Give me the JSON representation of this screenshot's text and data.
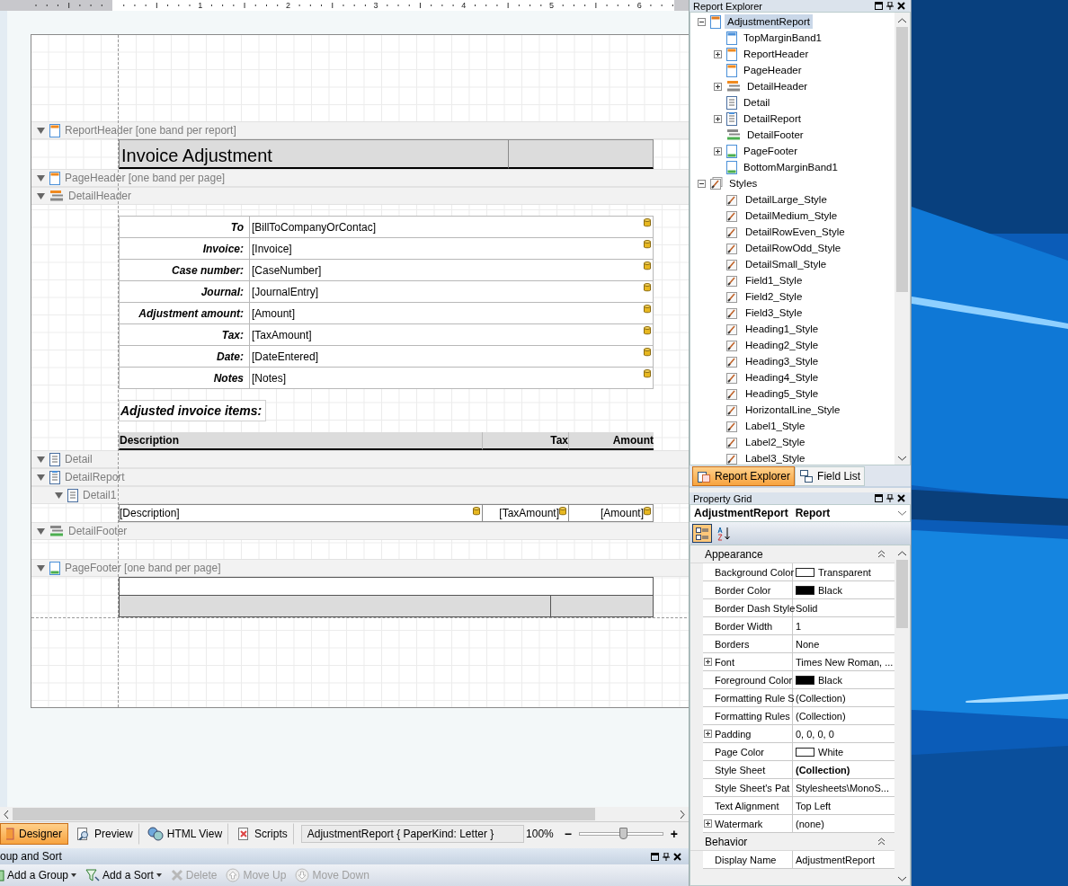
{
  "ruler": {
    "marks": [
      "1",
      "2",
      "3",
      "4",
      "5",
      "6"
    ]
  },
  "designer": {
    "bands": [
      {
        "label": "ReportHeader [one band per report]",
        "kind": "report-header",
        "expanded": true,
        "title": "Invoice Adjustment"
      },
      {
        "label": "PageHeader [one band per page]",
        "kind": "page-header",
        "expanded": true
      },
      {
        "label": "DetailHeader",
        "kind": "group-header",
        "expanded": true,
        "fields": [
          {
            "label": "To",
            "value": "[BillToCompanyOrContac]"
          },
          {
            "label": "Invoice:",
            "value": "[Invoice]"
          },
          {
            "label": "Case number:",
            "value": "[CaseNumber]"
          },
          {
            "label": "Journal:",
            "value": "[JournalEntry]"
          },
          {
            "label": "Adjustment amount:",
            "value": "[Amount]"
          },
          {
            "label": "Tax:",
            "value": "[TaxAmount]"
          },
          {
            "label": "Date:",
            "value": "[DateEntered]"
          },
          {
            "label": "Notes",
            "value": "[Notes]"
          }
        ],
        "caption": "Adjusted invoice items:",
        "columns": [
          "Description",
          "Tax",
          "Amount"
        ]
      },
      {
        "label": "Detail",
        "kind": "detail",
        "expanded": true
      },
      {
        "label": "DetailReport",
        "kind": "detail-report",
        "expanded": true,
        "children": [
          {
            "label": "Detail1",
            "kind": "detail",
            "expanded": true,
            "row": [
              "[Description]",
              "[TaxAmount]",
              "[Amount]"
            ]
          }
        ]
      },
      {
        "label": "DetailFooter",
        "kind": "group-footer",
        "expanded": true
      },
      {
        "label": "PageFooter [one band per page]",
        "kind": "page-footer",
        "expanded": true
      }
    ]
  },
  "view_tabs": [
    {
      "label": "Designer",
      "kind": "designer",
      "selected": true
    },
    {
      "label": "Preview",
      "kind": "preview",
      "selected": false
    },
    {
      "label": "HTML View",
      "kind": "html",
      "selected": false
    },
    {
      "label": "Scripts",
      "kind": "scripts",
      "selected": false
    }
  ],
  "status": "AdjustmentReport { PaperKind: Letter }",
  "zoom": {
    "reading": "100%",
    "minus": "−",
    "plus": "+",
    "level": 0.52
  },
  "group_sort": {
    "title": "oup and Sort",
    "tools": [
      {
        "label": "Add a Group",
        "kind": "add-group",
        "disabled": false,
        "dropdown": true
      },
      {
        "label": "Add a Sort",
        "kind": "add-sort",
        "disabled": false,
        "dropdown": true
      },
      {
        "label": "Delete",
        "kind": "delete",
        "disabled": true,
        "dropdown": false
      },
      {
        "label": "Move Up",
        "kind": "up",
        "disabled": true,
        "dropdown": false
      },
      {
        "label": "Move Down",
        "kind": "down",
        "disabled": true,
        "dropdown": false
      }
    ]
  },
  "report_explorer": {
    "title": "Report Explorer",
    "tree": [
      {
        "label": "AdjustmentReport",
        "kind": "report",
        "expanded": true,
        "selected": true,
        "children": [
          {
            "label": "TopMarginBand1",
            "kind": "margin-top",
            "selected": false
          },
          {
            "label": "ReportHeader",
            "kind": "report-header",
            "expanded": false,
            "selected": false
          },
          {
            "label": "PageHeader",
            "kind": "page-header",
            "selected": false
          },
          {
            "label": "DetailHeader",
            "kind": "group-header",
            "expanded": false,
            "selected": false
          },
          {
            "label": "Detail",
            "kind": "detail",
            "selected": false
          },
          {
            "label": "DetailReport",
            "kind": "detail-report",
            "expanded": false,
            "selected": false
          },
          {
            "label": "DetailFooter",
            "kind": "group-footer",
            "selected": false
          },
          {
            "label": "PageFooter",
            "kind": "page-footer",
            "expanded": false,
            "selected": false
          },
          {
            "label": "BottomMarginBand1",
            "kind": "margin-bottom",
            "selected": false
          }
        ]
      },
      {
        "label": "Styles",
        "kind": "styles",
        "expanded": true,
        "selected": false,
        "children": [
          {
            "label": "DetailLarge_Style",
            "kind": "style",
            "selected": false
          },
          {
            "label": "DetailMedium_Style",
            "kind": "style",
            "selected": false
          },
          {
            "label": "DetailRowEven_Style",
            "kind": "style",
            "selected": false
          },
          {
            "label": "DetailRowOdd_Style",
            "kind": "style",
            "selected": false
          },
          {
            "label": "DetailSmall_Style",
            "kind": "style",
            "selected": false
          },
          {
            "label": "Field1_Style",
            "kind": "style",
            "selected": false
          },
          {
            "label": "Field2_Style",
            "kind": "style",
            "selected": false
          },
          {
            "label": "Field3_Style",
            "kind": "style",
            "selected": false
          },
          {
            "label": "Heading1_Style",
            "kind": "style",
            "selected": false
          },
          {
            "label": "Heading2_Style",
            "kind": "style",
            "selected": false
          },
          {
            "label": "Heading3_Style",
            "kind": "style",
            "selected": false
          },
          {
            "label": "Heading4_Style",
            "kind": "style",
            "selected": false
          },
          {
            "label": "Heading5_Style",
            "kind": "style",
            "selected": false
          },
          {
            "label": "HorizontalLine_Style",
            "kind": "style",
            "selected": false
          },
          {
            "label": "Label1_Style",
            "kind": "style",
            "selected": false
          },
          {
            "label": "Label2_Style",
            "kind": "style",
            "selected": false
          },
          {
            "label": "Label3_Style",
            "kind": "style",
            "selected": false
          }
        ]
      }
    ],
    "tabs": [
      {
        "label": "Report Explorer",
        "kind": "explorer",
        "selected": true
      },
      {
        "label": "Field List",
        "kind": "fields",
        "selected": false
      }
    ]
  },
  "property_grid": {
    "title": "Property Grid",
    "object_name": "AdjustmentReport",
    "object_type": "Report",
    "sort_modes": [
      {
        "kind": "categorized",
        "selected": true
      },
      {
        "kind": "alphabetical",
        "selected": false
      }
    ],
    "categories": [
      {
        "name": "Appearance",
        "expanded": true,
        "rows": [
          {
            "name": "Background Color",
            "value": "Transparent",
            "kind": "color",
            "color": "#ffffff",
            "bold": false
          },
          {
            "name": "Border Color",
            "value": "Black",
            "kind": "color",
            "color": "#000000",
            "bold": false
          },
          {
            "name": "Border Dash Style",
            "value": "Solid",
            "kind": "text",
            "bold": false
          },
          {
            "name": "Border Width",
            "value": "1",
            "kind": "text",
            "bold": false
          },
          {
            "name": "Borders",
            "value": "None",
            "kind": "text",
            "bold": false
          },
          {
            "name": "Font",
            "value": "Times New Roman, ...",
            "kind": "expandable",
            "bold": false
          },
          {
            "name": "Foreground Color",
            "value": "Black",
            "kind": "color",
            "color": "#000000",
            "bold": false
          },
          {
            "name": "Formatting Rule S",
            "value": "(Collection)",
            "kind": "text",
            "bold": false
          },
          {
            "name": "Formatting Rules",
            "value": "(Collection)",
            "kind": "text",
            "bold": false
          },
          {
            "name": "Padding",
            "value": "0, 0, 0, 0",
            "kind": "expandable",
            "bold": false
          },
          {
            "name": "Page Color",
            "value": "White",
            "kind": "color",
            "color": "#ffffff",
            "bold": false
          },
          {
            "name": "Style Sheet",
            "value": "(Collection)",
            "kind": "text",
            "bold": true
          },
          {
            "name": "Style Sheet's Pat",
            "value": "Stylesheets\\MonoS...",
            "kind": "text",
            "bold": false
          },
          {
            "name": "Text Alignment",
            "value": "Top Left",
            "kind": "text",
            "bold": false
          },
          {
            "name": "Watermark",
            "value": "(none)",
            "kind": "expandable",
            "bold": false
          }
        ]
      },
      {
        "name": "Behavior",
        "expanded": true,
        "rows": [
          {
            "name": "Display Name",
            "value": "AdjustmentReport",
            "kind": "text",
            "bold": false
          }
        ]
      }
    ]
  }
}
